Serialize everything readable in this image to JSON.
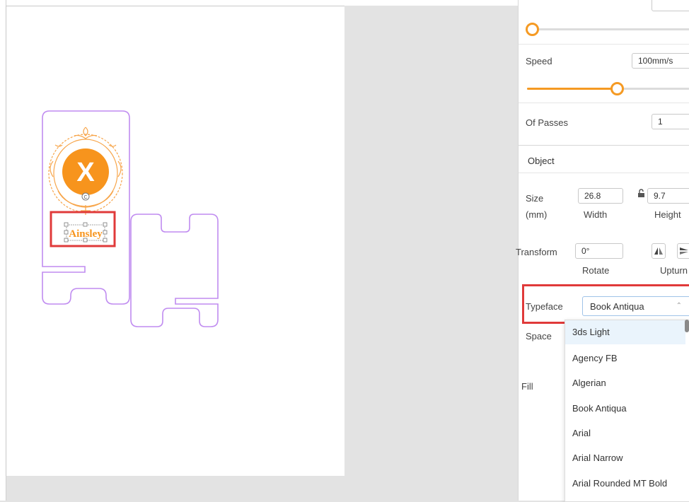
{
  "panel": {
    "speed_label": "Speed",
    "speed_value": "100mm/s",
    "speed_slider_level": 0.34,
    "power_slider_level": 0.0,
    "passes_label": "Of Passes",
    "passes_value": "1",
    "object_header": "Object",
    "size_label": "Size",
    "size_unit": "(mm)",
    "width_value": "26.8",
    "width_label": "Width",
    "height_value": "9.7",
    "height_label": "Height",
    "transform_label": "Transform",
    "rotate_value": "0°",
    "rotate_label": "Rotate",
    "upturn_label": "Upturn",
    "typeface_label": "Typeface",
    "typeface_value": "Book Antiqua",
    "space_label": "Space",
    "fill_label": "Fill"
  },
  "font_options": [
    "3ds Light",
    "Agency FB",
    "Algerian",
    "Book Antiqua",
    "Arial",
    "Arial Narrow",
    "Arial Rounded MT Bold"
  ],
  "canvas": {
    "engraved_text": "Ainsley",
    "logo_letter": "X",
    "rotate_handle": "C"
  },
  "colors": {
    "accent": "#f59a23",
    "cut_outline": "#c08cf0",
    "highlight": "#e03a3a",
    "logo_orange": "#f7941d"
  }
}
